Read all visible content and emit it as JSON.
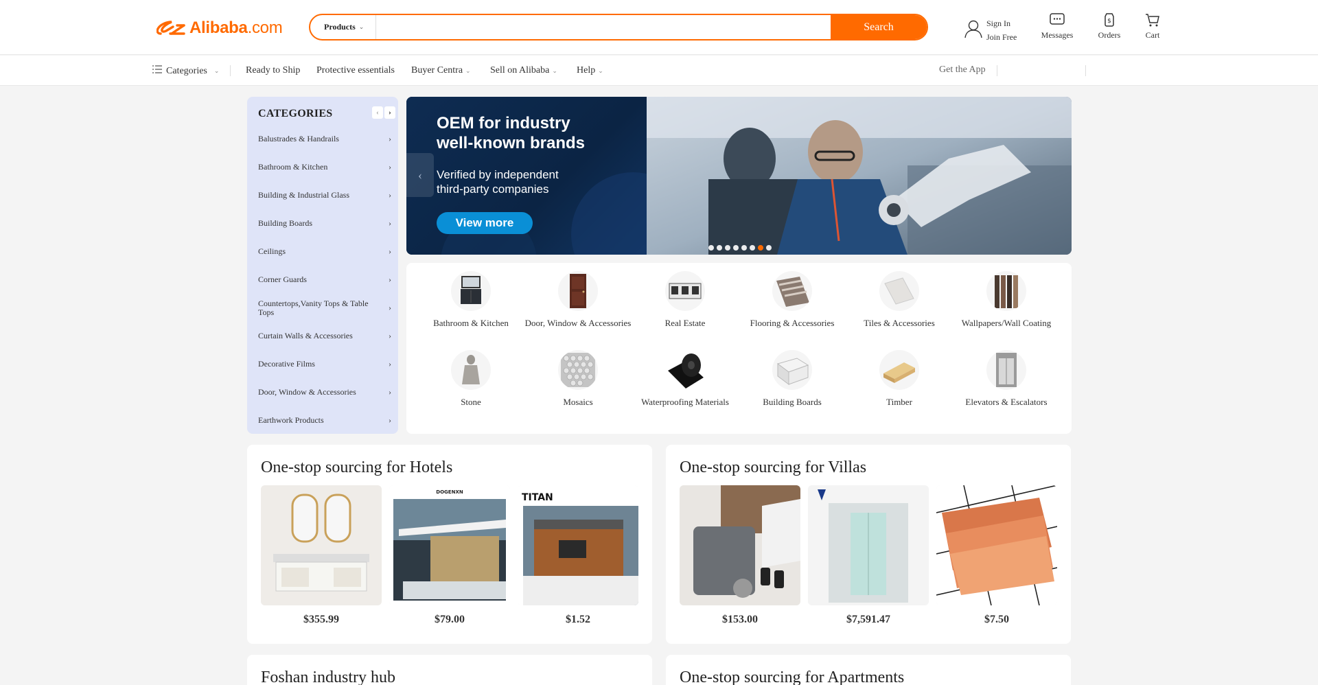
{
  "header": {
    "logo_text": "Alibaba",
    "logo_suffix": ".com",
    "search_category": "Products",
    "search_placeholder": "",
    "search_button": "Search",
    "sign_in": "Sign In",
    "join_free": "Join Free",
    "messages": "Messages",
    "orders": "Orders",
    "cart": "Cart"
  },
  "nav": {
    "categories": "Categories",
    "items": [
      "Ready to Ship",
      "Protective essentials",
      "Buyer Centra",
      "Sell on Alibaba",
      "Help"
    ],
    "get_app": "Get the App"
  },
  "sidebar": {
    "title": "CATEGORIES",
    "items": [
      "Balustrades & Handrails",
      "Bathroom & Kitchen",
      "Building & Industrial Glass",
      "Building Boards",
      "Ceilings",
      "Corner Guards",
      "Countertops,Vanity Tops & Table Tops",
      "Curtain Walls & Accessories",
      "Decorative Films",
      "Door, Window & Accessories",
      "Earthwork Products"
    ]
  },
  "banner": {
    "headline_1": "OEM for industry",
    "headline_2": "well-known brands",
    "sub_1": "Verified by independent",
    "sub_2": "third-party companies",
    "cta": "View more",
    "slide_count": 8,
    "active_slide": 7
  },
  "category_grid": [
    {
      "label": "Bathroom & Kitchen",
      "icon": "cabinet-icon"
    },
    {
      "label": "Door, Window & Accessories",
      "icon": "door-icon"
    },
    {
      "label": "Real Estate",
      "icon": "container-house-icon"
    },
    {
      "label": "Flooring & Accessories",
      "icon": "flooring-planks-icon"
    },
    {
      "label": "Tiles & Accessories",
      "icon": "tiles-icon"
    },
    {
      "label": "Wallpapers/Wall Coating",
      "icon": "wall-panels-icon"
    },
    {
      "label": "Stone",
      "icon": "stone-statue-icon"
    },
    {
      "label": "Mosaics",
      "icon": "mosaic-icon"
    },
    {
      "label": "Waterproofing Materials",
      "icon": "membrane-roll-icon"
    },
    {
      "label": "Building Boards",
      "icon": "board-icon"
    },
    {
      "label": "Timber",
      "icon": "timber-icon"
    },
    {
      "label": "Elevators & Escalators",
      "icon": "elevator-icon"
    }
  ],
  "cards": [
    {
      "title": "One-stop sourcing for Hotels",
      "products": [
        {
          "price": "$355.99",
          "image": "vanity-mirror"
        },
        {
          "price": "$79.00",
          "image": "modern-house",
          "brand": "DOGENXN"
        },
        {
          "price": "$1.52",
          "image": "wood-house",
          "brand": "TITAN"
        }
      ]
    },
    {
      "title": "One-stop sourcing for Villas",
      "products": [
        {
          "price": "$153.00",
          "image": "gate-motor"
        },
        {
          "price": "$7,591.47",
          "image": "glass-elevator"
        },
        {
          "price": "$7.50",
          "image": "cultured-stone"
        }
      ]
    },
    {
      "title": "Foshan industry hub",
      "products": []
    },
    {
      "title": "One-stop sourcing for Apartments",
      "products": []
    }
  ],
  "colors": {
    "accent": "#ff6a00",
    "banner_navy": "#0e2c52",
    "cta_blue": "#0a8fd6",
    "sidebar_bg": "#dfe4f8"
  }
}
